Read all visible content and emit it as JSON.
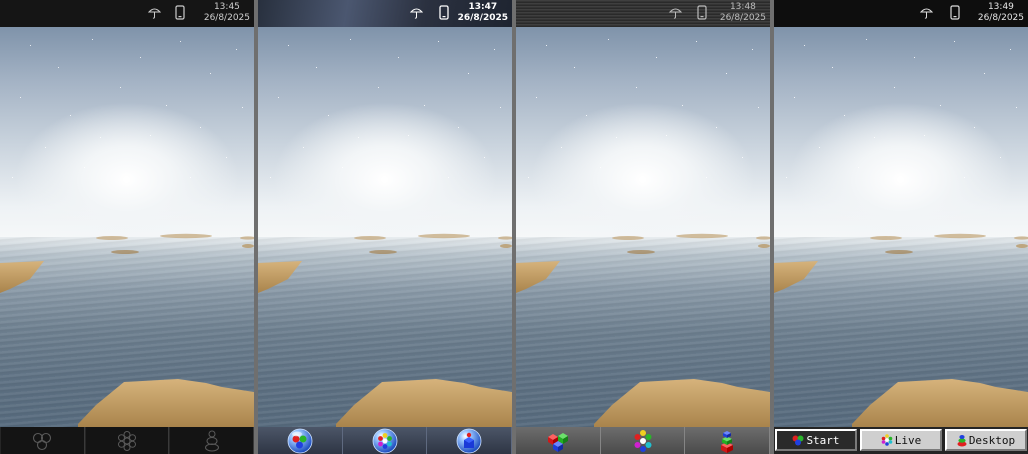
{
  "panels": [
    {
      "time": "13:45",
      "date": "26/8/2025",
      "icons": [
        "umbrella-icon",
        "phone-icon"
      ]
    },
    {
      "time": "13:47",
      "date": "26/8/2025",
      "icons": [
        "umbrella-icon",
        "phone-icon"
      ]
    },
    {
      "time": "13:48",
      "date": "26/8/2025",
      "icons": [
        "umbrella-icon",
        "phone-icon"
      ]
    },
    {
      "time": "13:49",
      "date": "26/8/2025",
      "icons": [
        "umbrella-icon",
        "phone-icon"
      ]
    }
  ],
  "taskbar_buttons": {
    "panel4": {
      "start": "Start",
      "live": "Live",
      "desktop": "Desktop"
    }
  },
  "colors": {
    "red": "#e02020",
    "green": "#2ab52a",
    "blue": "#2040e0",
    "yellow": "#f0d020",
    "magenta": "#d020d0",
    "sand": "#c9a46a"
  }
}
